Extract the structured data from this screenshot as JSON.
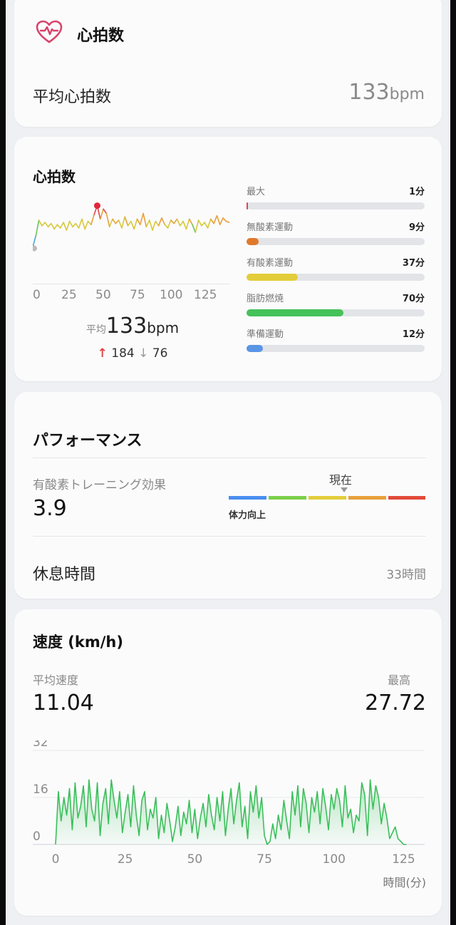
{
  "heart_summary": {
    "title": "心拍数",
    "avg_label": "平均心拍数",
    "avg_value": "133",
    "avg_unit": "bpm"
  },
  "heart_detail": {
    "title": "心拍数",
    "chart_ticks": [
      "0",
      "25",
      "50",
      "75",
      "100",
      "125"
    ],
    "avg_prefix": "平均",
    "avg_value": "133",
    "avg_unit": "bpm",
    "max_value": "184",
    "min_value": "76",
    "zones": [
      {
        "label": "最大",
        "value": "1分",
        "minutes": 1,
        "color": "#e0454a"
      },
      {
        "label": "無酸素運動",
        "value": "9分",
        "minutes": 9,
        "color": "#e07a2a"
      },
      {
        "label": "有酸素運動",
        "value": "37分",
        "minutes": 37,
        "color": "#e3cd3a"
      },
      {
        "label": "脂肪燃焼",
        "value": "70分",
        "minutes": 70,
        "color": "#45c25a"
      },
      {
        "label": "準備運動",
        "value": "12分",
        "minutes": 12,
        "color": "#5a95e6"
      }
    ]
  },
  "performance": {
    "title": "パフォーマンス",
    "aerobic_label": "有酸素トレーニング効果",
    "aerobic_value": "3.9",
    "current_label": "現在",
    "effect_label": "体力向上",
    "scale_colors": [
      "#4a8ef0",
      "#7ccf4a",
      "#e3cd3a",
      "#e8a03a",
      "#e24a3a"
    ],
    "rest_label": "休息時間",
    "rest_value": "33時間"
  },
  "speed": {
    "title": "速度 (km/h)",
    "avg_label": "平均速度",
    "avg_value": "11.04",
    "max_label": "最高",
    "max_value": "27.72",
    "y_ticks": [
      "32",
      "16",
      "0"
    ],
    "x_ticks": [
      "0",
      "25",
      "50",
      "75",
      "100",
      "125"
    ],
    "x_unit": "時間(分)",
    "line_color": "#3bbf5a"
  },
  "chart_data": [
    {
      "type": "line",
      "title": "心拍数",
      "xlabel": "",
      "ylabel": "",
      "x_ticks": [
        0,
        25,
        50,
        75,
        100,
        125
      ],
      "xlim": [
        0,
        130
      ],
      "series": [
        {
          "x": [
            0,
            2,
            4,
            6,
            8,
            10,
            12,
            14,
            16,
            18,
            20,
            22,
            24,
            26,
            28,
            30,
            32,
            34,
            36,
            38,
            40,
            42,
            44,
            46,
            48,
            50,
            52,
            54,
            56,
            58,
            60,
            62,
            64,
            66,
            68,
            70,
            72,
            74,
            76,
            78,
            80,
            82,
            84,
            86,
            88,
            90,
            92,
            94,
            96,
            98,
            100,
            102,
            104,
            106,
            108,
            110,
            112,
            114,
            116,
            118,
            120,
            122,
            124,
            126,
            128
          ],
          "values": [
            100,
            120,
            148,
            138,
            144,
            136,
            142,
            132,
            140,
            134,
            144,
            130,
            146,
            136,
            142,
            134,
            150,
            132,
            146,
            140,
            158,
            174,
            150,
            168,
            160,
            136,
            150,
            142,
            148,
            134,
            154,
            138,
            146,
            132,
            150,
            140,
            160,
            136,
            148,
            130,
            146,
            138,
            152,
            140,
            134,
            148,
            142,
            150,
            138,
            146,
            132,
            150,
            140,
            126,
            148,
            138,
            144,
            134,
            150,
            142,
            156,
            140,
            152,
            146,
            144
          ]
        }
      ]
    },
    {
      "type": "area",
      "title": "速度 (km/h)",
      "xlabel": "時間(分)",
      "ylabel": "",
      "xlim": [
        0,
        130
      ],
      "ylim": [
        0,
        32
      ],
      "x_ticks": [
        0,
        25,
        50,
        75,
        100,
        125
      ],
      "y_ticks": [
        0,
        16,
        32
      ],
      "series": [
        {
          "x": [
            0,
            1,
            2,
            3,
            4,
            5,
            6,
            7,
            8,
            9,
            10,
            11,
            12,
            13,
            14,
            15,
            16,
            17,
            18,
            19,
            20,
            21,
            22,
            23,
            24,
            25,
            26,
            27,
            28,
            29,
            30,
            31,
            32,
            33,
            34,
            35,
            36,
            37,
            38,
            39,
            40,
            41,
            42,
            43,
            44,
            45,
            46,
            47,
            48,
            49,
            50,
            51,
            52,
            53,
            54,
            55,
            56,
            57,
            58,
            59,
            60,
            61,
            62,
            63,
            64,
            65,
            66,
            67,
            68,
            69,
            70,
            71,
            72,
            73,
            74,
            75,
            76,
            77,
            78,
            79,
            80,
            81,
            82,
            83,
            84,
            85,
            86,
            87,
            88,
            89,
            90,
            91,
            92,
            93,
            94,
            95,
            96,
            97,
            98,
            99,
            100,
            101,
            102,
            103,
            104,
            105,
            106,
            107,
            108,
            109,
            110,
            111,
            112,
            113,
            114,
            115,
            116,
            117,
            118,
            119,
            120,
            121,
            122,
            123,
            124,
            125,
            126
          ],
          "values": [
            0,
            18,
            8,
            16,
            10,
            19,
            5,
            21,
            9,
            13,
            20,
            6,
            22,
            12,
            8,
            21,
            3,
            14,
            19,
            7,
            22,
            15,
            9,
            18,
            4,
            11,
            17,
            6,
            20,
            10,
            3,
            15,
            18,
            5,
            12,
            9,
            16,
            2,
            10,
            4,
            14,
            8,
            1,
            6,
            13,
            3,
            11,
            7,
            15,
            4,
            12,
            2,
            9,
            14,
            6,
            17,
            10,
            5,
            16,
            8,
            18,
            3,
            12,
            19,
            7,
            15,
            21,
            6,
            13,
            2,
            18,
            11,
            20,
            9,
            16,
            3,
            0,
            1,
            7,
            2,
            10,
            5,
            15,
            8,
            2,
            18,
            10,
            20,
            6,
            19,
            14,
            4,
            16,
            11,
            18,
            7,
            19,
            13,
            5,
            17,
            12,
            19,
            15,
            6,
            20,
            9,
            12,
            4,
            10,
            8,
            21,
            17,
            3,
            22,
            12,
            20,
            16,
            7,
            14,
            9,
            2,
            4,
            6,
            2,
            1,
            0,
            0
          ]
        }
      ]
    }
  ]
}
